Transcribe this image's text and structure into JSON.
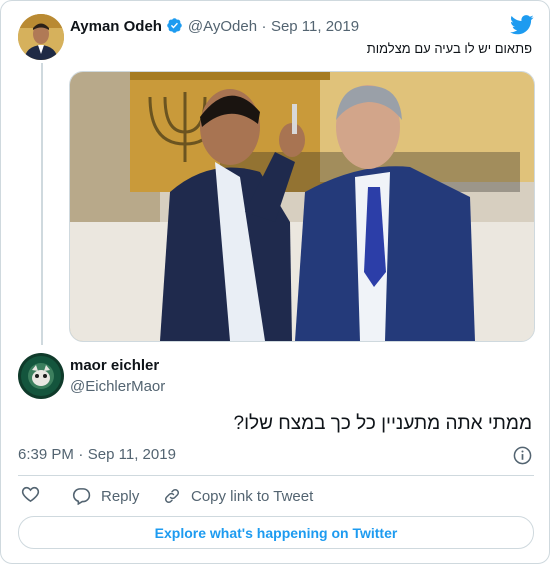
{
  "quoted": {
    "author_name": "Ayman Odeh",
    "handle": "@AyOdeh",
    "separator": "·",
    "date": "Sep 11, 2019",
    "text": "פתאום יש לו בעיה עם מצלמות"
  },
  "reply": {
    "author_name": "maor eichler",
    "handle": "@EichlerMaor",
    "text": "ממתי אתה מתעניין כל כך במצח שלו?",
    "time": "6:39 PM",
    "separator": "·",
    "date": "Sep 11, 2019"
  },
  "actions": {
    "reply_label": "Reply",
    "copy_label": "Copy link to Tweet"
  },
  "explore_label": "Explore what's happening on Twitter",
  "colors": {
    "twitter_blue": "#1d9bf0",
    "text": "#0f1419",
    "muted": "#536471",
    "border": "#cfd9de"
  },
  "icons": [
    "twitter-bird-icon",
    "verified-badge-icon",
    "info-icon",
    "heart-icon",
    "reply-bubble-icon",
    "link-icon"
  ]
}
